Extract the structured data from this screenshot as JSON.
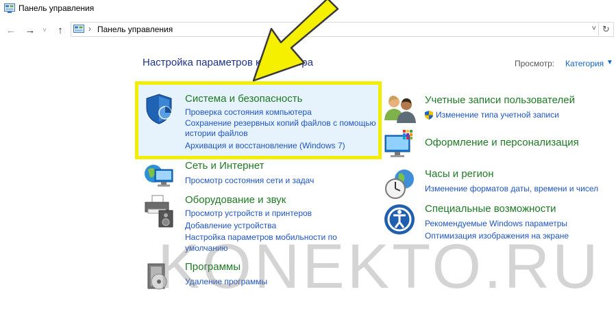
{
  "window": {
    "title": "Панель управления"
  },
  "address": {
    "path": "Панель управления"
  },
  "page": {
    "title": "Настройка параметров компьютера",
    "view_label": "Просмотр:",
    "view_value": "Категория"
  },
  "categories": [
    {
      "name": "Система и безопасность",
      "icon": "security-shield-icon",
      "links": [
        "Проверка состояния компьютера",
        "Сохранение резервных копий файлов с помощью истории файлов",
        "Архивация и восстановление (Windows 7)"
      ]
    },
    {
      "name": "Сеть и Интернет",
      "icon": "network-globe-icon",
      "links": [
        "Просмотр состояния сети и задач"
      ]
    },
    {
      "name": "Оборудование и звук",
      "icon": "printer-speaker-icon",
      "links": [
        "Просмотр устройств и принтеров",
        "Добавление устройства",
        "Настройка параметров мобильности по умолчанию"
      ]
    },
    {
      "name": "Программы",
      "icon": "programs-disc-icon",
      "links": [
        "Удаление программы"
      ]
    },
    {
      "name": "Учетные записи пользователей",
      "icon": "user-accounts-icon",
      "links": [
        "Изменение типа учетной записи"
      ]
    },
    {
      "name": "Оформление и персонализация",
      "icon": "display-palette-icon",
      "links": []
    },
    {
      "name": "Часы и регион",
      "icon": "clock-globe-icon",
      "links": [
        "Изменение форматов даты, времени и чисел"
      ]
    },
    {
      "name": "Специальные возможности",
      "icon": "ease-of-access-icon",
      "links": [
        "Рекомендуемые Windows параметры",
        "Оптимизация изображения на экране"
      ]
    }
  ],
  "watermark": "KONEKTO.RU",
  "colors": {
    "category_heading": "#1e7a24",
    "link": "#1e54c2",
    "page_title": "#1e3287",
    "highlight_border": "#f2ee00",
    "arrow_fill": "#f4f000"
  }
}
